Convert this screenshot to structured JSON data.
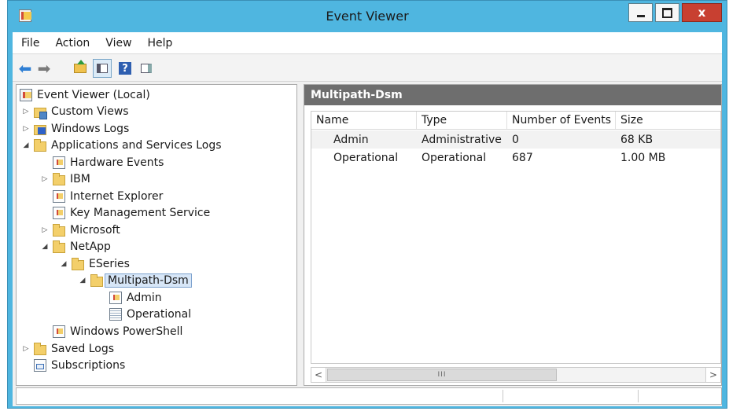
{
  "window": {
    "title": "Event Viewer"
  },
  "title_buttons": {
    "close": "x"
  },
  "menu": [
    "File",
    "Action",
    "View",
    "Help"
  ],
  "toolbar": {
    "back_icon": "arrow-left-icon",
    "forward_icon": "arrow-right-icon",
    "help": "?"
  },
  "tree": [
    {
      "label": "Event Viewer (Local)",
      "icon": "event-viewer-icon",
      "expander": ""
    },
    {
      "label": "Custom Views",
      "icon": "custom-views-icon",
      "expander": "▷"
    },
    {
      "label": "Windows Logs",
      "icon": "windows-logs-icon",
      "expander": "▷"
    },
    {
      "label": "Applications and Services Logs",
      "icon": "folder-open-icon",
      "expander": "◢"
    },
    {
      "label": "Hardware Events",
      "icon": "event-log-icon",
      "expander": ""
    },
    {
      "label": "IBM",
      "icon": "folder-icon",
      "expander": "▷"
    },
    {
      "label": "Internet Explorer",
      "icon": "event-log-icon",
      "expander": ""
    },
    {
      "label": "Key Management Service",
      "icon": "event-log-icon",
      "expander": ""
    },
    {
      "label": "Microsoft",
      "icon": "folder-icon",
      "expander": "▷"
    },
    {
      "label": "NetApp",
      "icon": "folder-open-icon",
      "expander": "◢"
    },
    {
      "label": "ESeries",
      "icon": "folder-open-icon",
      "expander": "◢"
    },
    {
      "label": "Multipath-Dsm",
      "icon": "folder-open-icon",
      "expander": "◢"
    },
    {
      "label": "Admin",
      "icon": "event-log-icon",
      "expander": ""
    },
    {
      "label": "Operational",
      "icon": "operational-log-icon",
      "expander": ""
    },
    {
      "label": "Windows PowerShell",
      "icon": "event-log-icon",
      "expander": ""
    },
    {
      "label": "Saved Logs",
      "icon": "saved-logs-icon",
      "expander": "▷"
    },
    {
      "label": "Subscriptions",
      "icon": "subscriptions-icon",
      "expander": ""
    }
  ],
  "pane": {
    "title": "Multipath-Dsm",
    "columns": [
      "Name",
      "Type",
      "Number of Events",
      "Size"
    ],
    "rows": [
      {
        "name": "Admin",
        "type": "Administrative",
        "events": "0",
        "size": "68 KB"
      },
      {
        "name": "Operational",
        "type": "Operational",
        "events": "687",
        "size": "1.00 MB"
      }
    ]
  },
  "scrollbar": {
    "left_arrow": "<",
    "right_arrow": ">",
    "thumb_grip": "III"
  },
  "colors": {
    "titlebar": "#4fb6e0",
    "close_button": "#c84031",
    "pane_header": "#6e6e6e",
    "selection": "#d7e6f7"
  }
}
